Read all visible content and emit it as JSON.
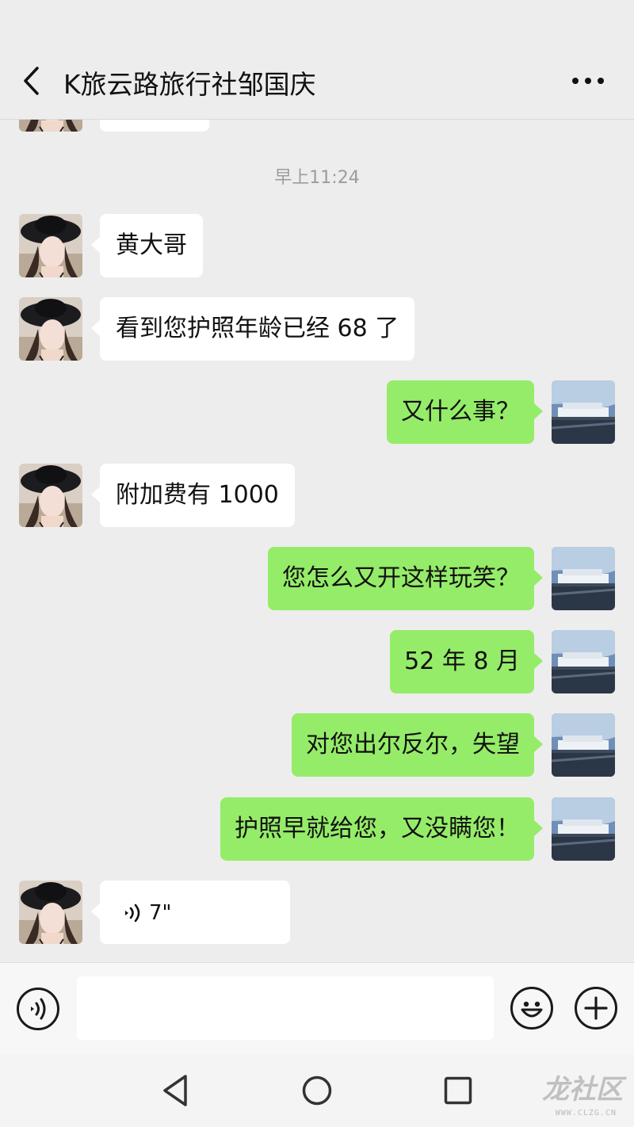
{
  "header": {
    "title": "K旅云路旅行社邹国庆",
    "back_icon": "chevron-left-icon",
    "more_icon": "more-dots-icon"
  },
  "chat": {
    "timestamp": "早上11:24",
    "messages": [
      {
        "side": "left",
        "text": "黄大哥"
      },
      {
        "side": "left",
        "text": "看到您护照年龄已经 68 了"
      },
      {
        "side": "right",
        "text": "又什么事？"
      },
      {
        "side": "left",
        "text": "附加费有 1000"
      },
      {
        "side": "right",
        "text": "您怎么又开这样玩笑？"
      },
      {
        "side": "right",
        "text": "52 年 8 月"
      },
      {
        "side": "right",
        "text": "对您出尔反尔，失望"
      },
      {
        "side": "right",
        "text": "护照早就给您，又没瞒您！"
      },
      {
        "side": "left",
        "type": "voice",
        "duration": "7\"",
        "icon": "voice-wave-icon"
      }
    ]
  },
  "input_bar": {
    "voice_icon": "voice-mode-icon",
    "text_value": "",
    "emoji_icon": "emoji-icon",
    "plus_icon": "plus-icon"
  },
  "nav_bar": {
    "back_icon": "triangle-back-icon",
    "home_icon": "circle-home-icon",
    "recents_icon": "square-recents-icon"
  },
  "watermark": {
    "text": "龙社区",
    "sub": "WWW.CLZG.CN"
  },
  "colors": {
    "background": "#ededed",
    "bubble_self": "#95ec69",
    "bubble_other": "#ffffff"
  }
}
